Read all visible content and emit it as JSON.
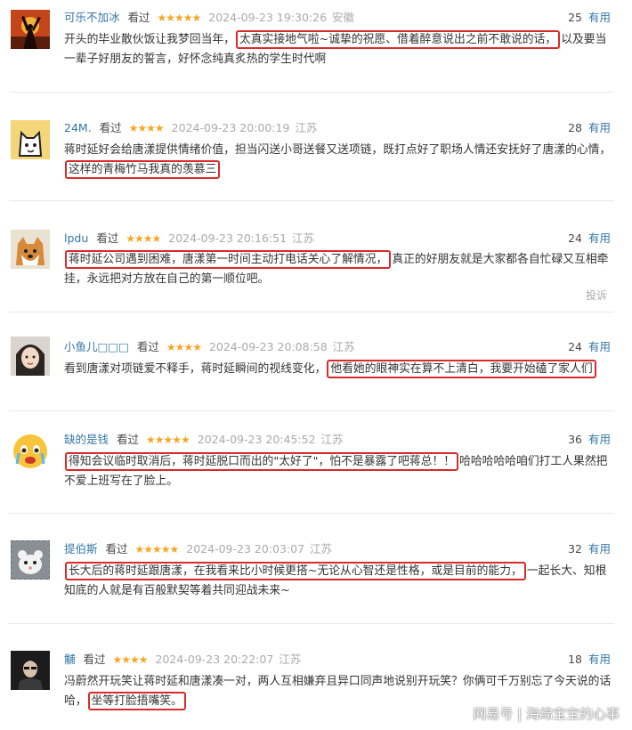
{
  "vote_label": "有用",
  "report_label": "投诉",
  "watermark": {
    "brand": "网易号",
    "separator": "|",
    "author": "海绵宝宝的心事"
  },
  "comments": [
    {
      "user": "可乐不加冰",
      "status": "看过",
      "stars": "★★★★★",
      "rating": 5,
      "time": "2024-09-23 19:30:26",
      "location": "安徽",
      "votes": "25",
      "text_before": "开头的毕业散伙饭让我梦回当年，",
      "highlight": "太真实接地气啦~诚挚的祝愿、借着醉意说出之前不敢说的话，",
      "text_after": "以及要当一辈子好朋友的誓言，好怀念纯真炙热的学生时代啊"
    },
    {
      "user": "24M.",
      "status": "看过",
      "stars": "★★★★",
      "rating": 4,
      "time": "2024-09-23 20:00:19",
      "location": "江苏",
      "votes": "28",
      "text_before": "蒋时延好会给唐漾提供情绪价值，担当闪送小哥送餐又送项链，既打点好了职场人情还安抚好了唐漾的心情，",
      "highlight": "这样的青梅竹马我真的羡慕三",
      "text_after": ""
    },
    {
      "user": "lpdu",
      "status": "看过",
      "stars": "★★★★",
      "rating": 4,
      "time": "2024-09-23 20:16:51",
      "location": "江苏",
      "votes": "24",
      "text_before": "",
      "highlight": "蒋时延公司遇到困难，唐漾第一时间主动打电话关心了解情况，",
      "text_after": "真正的好朋友就是大家都各自忙碌又互相牵挂，永远把对方放在自己的第一顺位吧。"
    },
    {
      "user": "小鱼儿□□□",
      "status": "看过",
      "stars": "★★★★",
      "rating": 4,
      "time": "2024-09-23 20:08:58",
      "location": "江苏",
      "votes": "24",
      "text_before": "看到唐漾对项链爱不释手，蒋时延瞬间的视线变化，",
      "highlight": "他看她的眼神实在算不上清白，我要开始磕了家人们",
      "text_after": ""
    },
    {
      "user": "缺的是钱",
      "status": "看过",
      "stars": "★★★★★",
      "rating": 5,
      "time": "2024-09-23 20:45:52",
      "location": "江苏",
      "votes": "36",
      "text_before": "",
      "highlight": "得知会议临时取消后，蒋时延脱口而出的\"太好了\"，怕不是暴露了吧蒋总！！",
      "text_after": "哈哈哈哈哈咱们打工人果然把不爱上班写在了脸上。"
    },
    {
      "user": "提伯斯",
      "status": "看过",
      "stars": "★★★★★",
      "rating": 5,
      "time": "2024-09-23 20:03:07",
      "location": "江苏",
      "votes": "32",
      "text_before": "",
      "highlight": "长大后的蒋时延跟唐漾，在我看来比小时候更搭~无论从心智还是性格，或是目前的能力，",
      "text_after": "一起长大、知根知底的人就是有百般默契等着共同迎战未来~"
    },
    {
      "user": "黼",
      "status": "看过",
      "stars": "★★★★",
      "rating": 4,
      "time": "2024-09-23 20:22:07",
      "location": "江苏",
      "votes": "18",
      "text_before": "冯蔚然开玩笑让蒋时延和唐漾凑一对，两人互相嫌弃且异口同声地说别开玩笑？你俩可千万别忘了今天说的话哈，",
      "highlight": "坐等打脸捂嘴笑。",
      "text_after": ""
    }
  ]
}
